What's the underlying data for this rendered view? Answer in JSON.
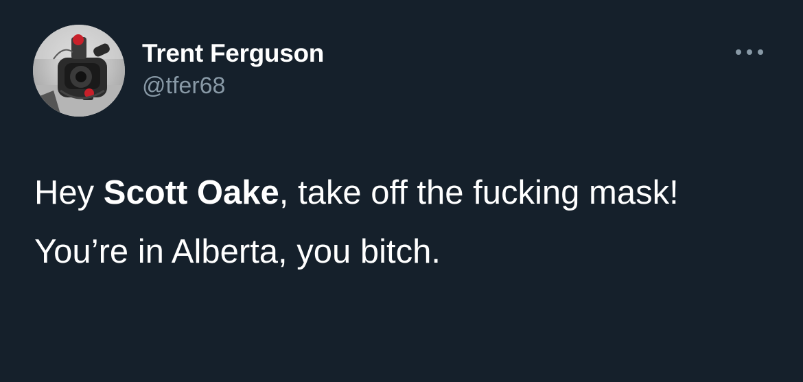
{
  "tweet": {
    "author": {
      "display_name": "Trent Ferguson",
      "handle": "@tfer68",
      "avatar_icon": "profile-photo"
    },
    "more_icon": "more-options-icon",
    "paragraphs": [
      {
        "prefix": "Hey ",
        "mention": "Scott Oake",
        "suffix": ", take off the fucking mask!"
      },
      {
        "text": "You’re in Alberta, you bitch."
      }
    ]
  },
  "colors": {
    "background": "#15202b",
    "text": "#ffffff",
    "secondary_text": "#8899a6"
  }
}
